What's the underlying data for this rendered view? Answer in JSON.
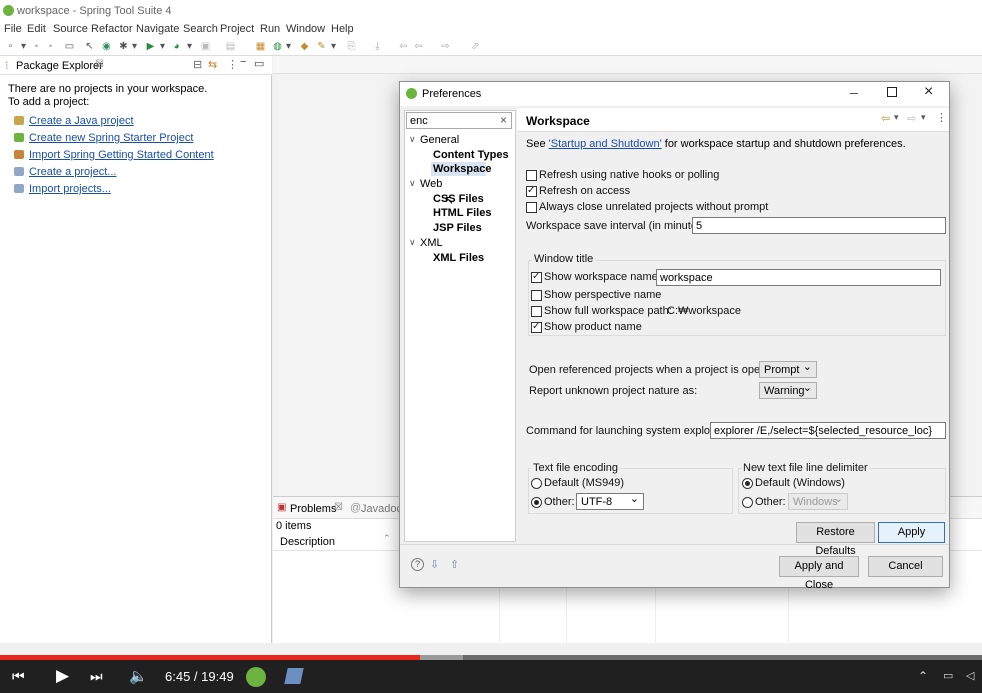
{
  "window": {
    "title": "workspace - Spring Tool Suite 4"
  },
  "menu": [
    "File",
    "Edit",
    "Source",
    "Refactor",
    "Navigate",
    "Search",
    "Project",
    "Run",
    "Window",
    "Help"
  ],
  "package_explorer": {
    "tab_label": "Package Explorer",
    "tab_close": "☒",
    "empty_line1": "There are no projects in your workspace.",
    "empty_line2": "To add a project:",
    "links": [
      "Create a Java project",
      "Create new Spring Starter Project",
      "Import Spring Getting Started Content",
      "Create a project...",
      "Import projects..."
    ]
  },
  "problems": {
    "tab_label": "Problems",
    "tab_close": "☒",
    "javadoc_label": "Javadoc",
    "count": "0 items",
    "col_description": "Description"
  },
  "dialog": {
    "title": "Preferences",
    "search": "enc",
    "tree": {
      "general": "General",
      "content_types": "Content Types",
      "workspace": "Workspace",
      "web": "Web",
      "css_files": "CSS Files",
      "html_files": "HTML Files",
      "jsp_files": "JSP Files",
      "xml": "XML",
      "xml_files": "XML Files"
    },
    "page": {
      "title": "Workspace",
      "see_prefix": "See ",
      "see_link": "'Startup and Shutdown'",
      "see_suffix": " for workspace startup and shutdown preferences.",
      "refresh_native": "Refresh using native hooks or polling",
      "refresh_access": "Refresh on access",
      "always_close": "Always close unrelated projects without prompt",
      "save_interval_label": "Workspace save interval (in minutes):",
      "save_interval_value": "5",
      "window_title_group": "Window title",
      "show_ws_name": "Show workspace name:",
      "ws_name_value": "workspace",
      "show_perspective": "Show perspective name",
      "show_full_path": "Show full workspace path:",
      "full_path_value": "C:₩workspace",
      "show_product": "Show product name",
      "open_ref_label": "Open referenced projects when a project is opened:",
      "open_ref_value": "Prompt",
      "report_nature_label": "Report unknown project nature as:",
      "report_nature_value": "Warning",
      "cmd_label": "Command for launching system explorer:",
      "cmd_value": "explorer /E,/select=${selected_resource_loc}",
      "encoding_group": "Text file encoding",
      "enc_default": "Default (MS949)",
      "enc_other": "Other:",
      "enc_other_value": "UTF-8",
      "delim_group": "New text file line delimiter",
      "delim_default": "Default (Windows)",
      "delim_other": "Other:",
      "delim_other_value": "Windows",
      "restore_defaults": "Restore Defaults",
      "apply": "Apply"
    },
    "apply_close": "Apply and Close",
    "cancel": "Cancel"
  },
  "video": {
    "time": "6:45 / 19:49",
    "progress": 0.428,
    "buffered": 0.471
  }
}
